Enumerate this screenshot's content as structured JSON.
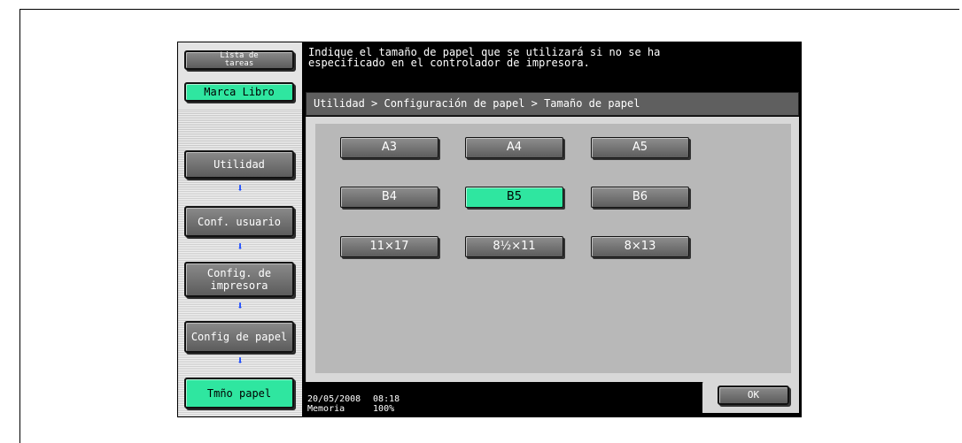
{
  "sidebar": {
    "task_list_label": "Lista de\ntareas",
    "bookmark_label": "Marca Libro",
    "steps": [
      {
        "label": "Utilidad"
      },
      {
        "label": "Conf. usuario"
      },
      {
        "label": "Config. de\nimpresora"
      },
      {
        "label": "Config de papel"
      },
      {
        "label": "Tmño papel"
      }
    ]
  },
  "message": "Indique el tamaño de papel que se utilizará si no se ha\nespecificado en el controlador de impresora.",
  "breadcrumb": "Utilidad > Configuración de papel > Tamaño de papel",
  "paper_sizes": {
    "a3": "A3",
    "a4": "A4",
    "a5": "A5",
    "b4": "B4",
    "b5": "B5",
    "b6": "B6",
    "s11x17": "11×17",
    "s85x11": "8½×11",
    "s8x13": "8×13",
    "selected": "B5"
  },
  "status": {
    "date": "20/05/2008",
    "time": "08:18",
    "memory_label": "Memoria",
    "memory_value": "100%"
  },
  "ok_label": "OK",
  "colors": {
    "selected_green": "#2fe6a0",
    "arrow_blue": "#1d4cff"
  },
  "icons": [
    "down-arrow-icon"
  ]
}
